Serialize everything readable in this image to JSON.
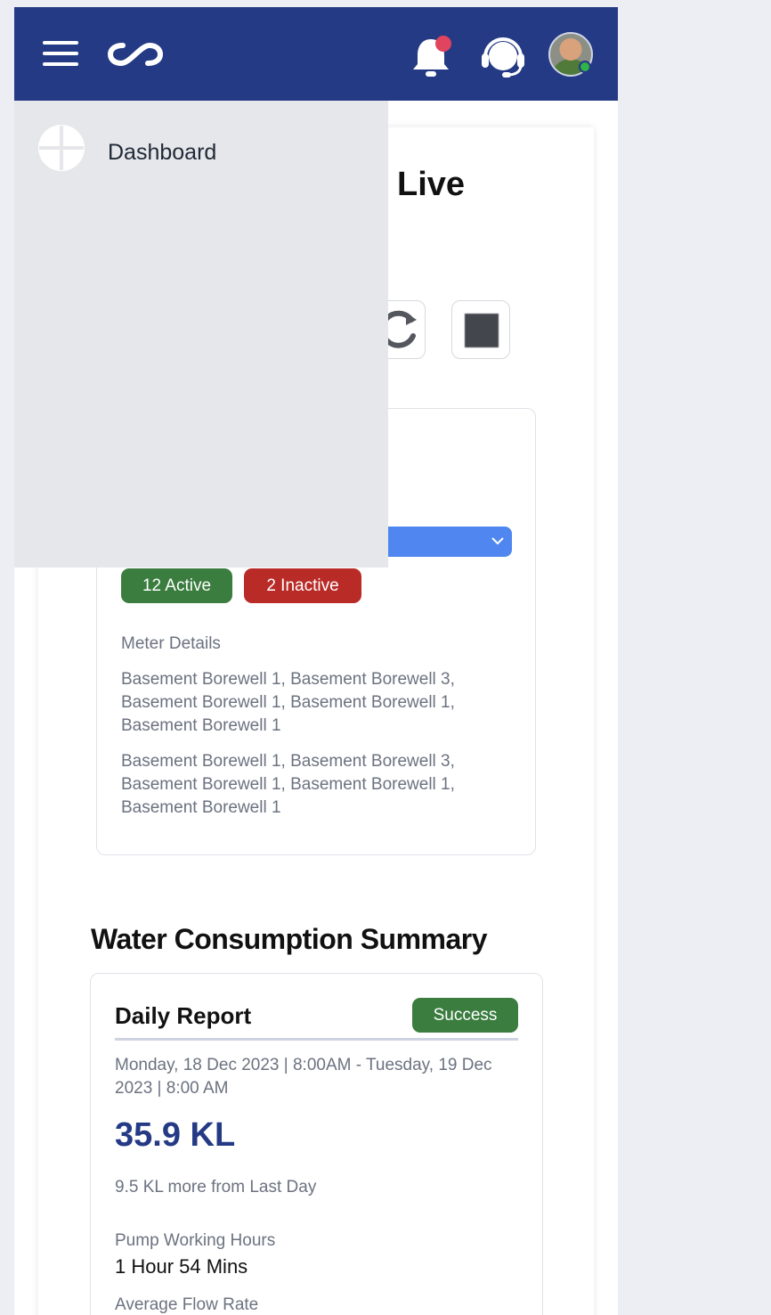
{
  "header": {
    "menu_icon": "hamburger-menu-icon",
    "logo_icon": "infinity-logo-icon",
    "notification_icon": "bell-icon",
    "support_icon": "headset-support-icon",
    "avatar": "user-avatar"
  },
  "drawer": {
    "items": [
      {
        "label": "Dashboard",
        "icon": "dashboard-icon"
      }
    ]
  },
  "live": {
    "title_visible_fragment": "Live",
    "refresh_icon": "refresh-icon",
    "stop_icon": "stop-icon"
  },
  "meters": {
    "active_badge": "12 Active",
    "inactive_badge": "2 Inactive",
    "details_label": "Meter Details",
    "details": [
      "Basement Borewell 1, Basement Borewell 3, Basement Borewell 1, Basement Borewell 1, Basement Borewell 1",
      "Basement Borewell 1, Basement Borewell 3, Basement Borewell 1, Basement Borewell 1, Basement Borewell 1"
    ]
  },
  "summary": {
    "section_title": "Water Consumption Summary",
    "report_title": "Daily Report",
    "status": "Success",
    "date_range": "Monday, 18 Dec 2023 | 8:00AM - Tuesday, 19 Dec 2023 | 8:00 AM",
    "consumption": "35.9 KL",
    "comparison": "9.5 KL more from Last Day",
    "pump_label": "Pump Working Hours",
    "pump_value": "1 Hour 54 Mins",
    "flow_label": "Average Flow Rate"
  },
  "colors": {
    "header": "#243a85",
    "active": "#3a7d3f",
    "inactive": "#b92b27",
    "select": "#4f86ef",
    "value": "#243a85"
  }
}
